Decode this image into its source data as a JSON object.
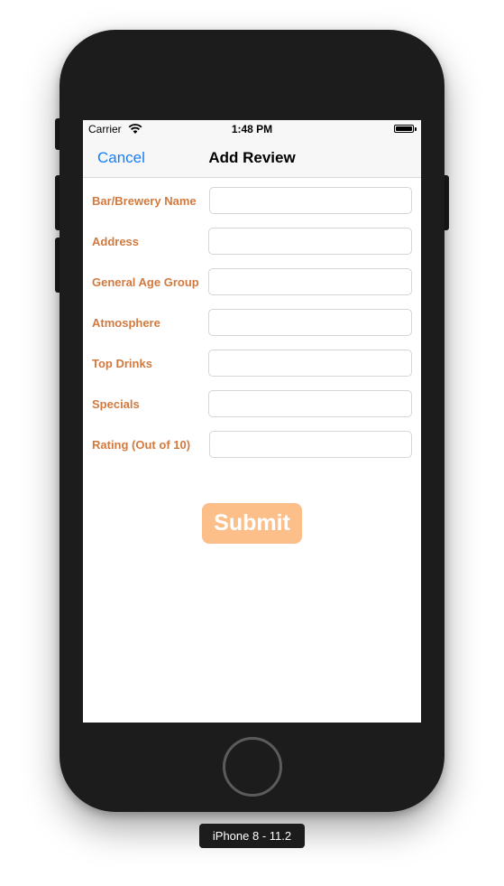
{
  "status_bar": {
    "carrier": "Carrier",
    "time": "1:48 PM",
    "icons": [
      "wifi-icon",
      "battery-icon"
    ]
  },
  "nav_bar": {
    "cancel_label": "Cancel",
    "title": "Add Review"
  },
  "form": {
    "fields": [
      {
        "label": "Bar/Brewery Name",
        "value": "",
        "placeholder": ""
      },
      {
        "label": "Address",
        "value": "",
        "placeholder": ""
      },
      {
        "label": "General Age Group",
        "value": "",
        "placeholder": ""
      },
      {
        "label": "Atmosphere",
        "value": "",
        "placeholder": ""
      },
      {
        "label": "Top Drinks",
        "value": "",
        "placeholder": ""
      },
      {
        "label": "Specials",
        "value": "",
        "placeholder": ""
      },
      {
        "label": "Rating (Out of 10)",
        "value": "",
        "placeholder": ""
      }
    ],
    "submit_label": "Submit"
  },
  "device": {
    "label": "iPhone 8 - 11.2"
  },
  "colors": {
    "label_orange": "#d17a3f",
    "submit_bg": "#fdbf8a",
    "link_blue": "#147efb",
    "bezel": "#1c1c1c"
  }
}
